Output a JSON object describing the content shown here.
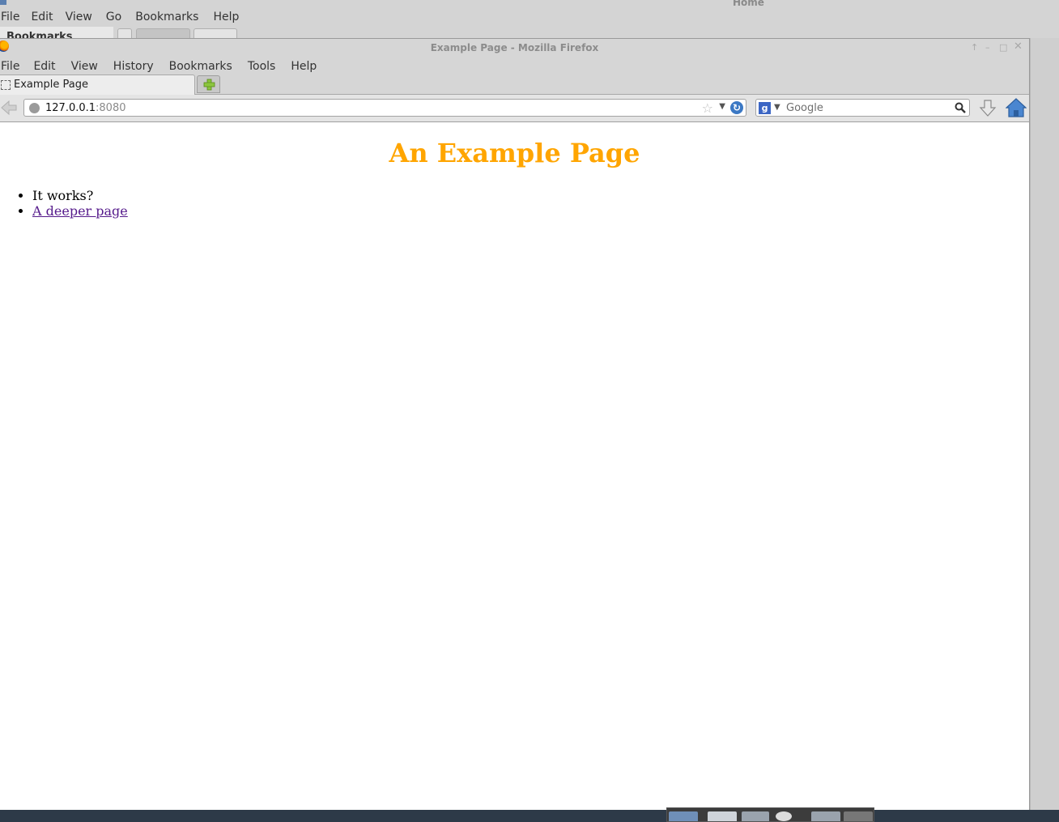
{
  "background_window": {
    "title": "Home",
    "menu": [
      "File",
      "Edit",
      "View",
      "Go",
      "Bookmarks",
      "Help"
    ],
    "sidebar_header": "Bookmarks"
  },
  "firefox": {
    "title": "Example Page - Mozilla Firefox",
    "menu": [
      "File",
      "Edit",
      "View",
      "History",
      "Bookmarks",
      "Tools",
      "Help"
    ],
    "tab": {
      "label": "Example Page"
    },
    "url": {
      "host": "127.0.0.1",
      "port": ":8080"
    },
    "search": {
      "placeholder": "Google",
      "engine_icon": "g"
    }
  },
  "page": {
    "heading": "An Example Page",
    "items": [
      {
        "text": "It works?"
      },
      {
        "link": "A deeper page"
      }
    ],
    "heading_color": "#ffa500",
    "link_color": "#551a8b"
  }
}
